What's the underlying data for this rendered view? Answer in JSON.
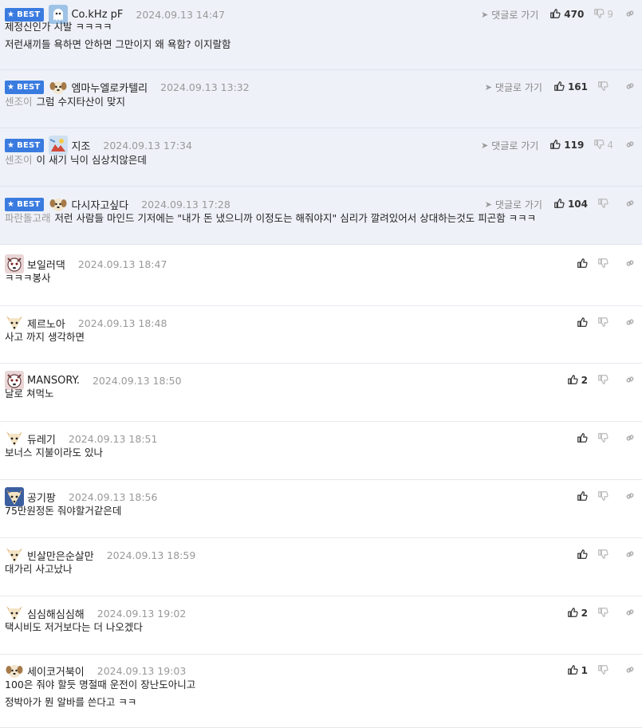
{
  "labels": {
    "best": "BEST",
    "goto_reply": "댓글로 가기"
  },
  "comments": [
    {
      "best": true,
      "nick": "Co.kHz pF",
      "date": "2024.09.13 14:47",
      "reply_to": "",
      "lines": [
        "제정신인가 시발 ㅋㅋㅋㅋ",
        "저런새끼들 욕하면 안하면 그만이지 왜 욕함? 이지랄함"
      ],
      "up": "470",
      "down": "9",
      "avatar": "ghost"
    },
    {
      "best": true,
      "nick": "엠마누엘로카텔리",
      "date": "2024.09.13 13:32",
      "reply_to": "센조이",
      "lines": [
        "그럼 수지타산이 맞지"
      ],
      "up": "161",
      "down": "",
      "avatar": "puppy"
    },
    {
      "best": true,
      "nick": "지조",
      "date": "2024.09.13 17:34",
      "reply_to": "센조이",
      "lines": [
        "이 새기 닉이 심상치않은데"
      ],
      "up": "119",
      "down": "4",
      "avatar": "art"
    },
    {
      "best": true,
      "nick": "다시자고싶다",
      "date": "2024.09.13 17:28",
      "reply_to": "파란돌고래",
      "lines": [
        "저런 사람들 마인드 기저에는 \"내가 돈 냈으니까 이정도는 해줘야지\" 심리가 깔려있어서 상대하는것도 피곤함 ㅋㅋㅋ"
      ],
      "up": "104",
      "down": "",
      "avatar": "puppy"
    },
    {
      "best": false,
      "nick": "보일러댁",
      "date": "2024.09.13 18:47",
      "reply_to": "",
      "lines": [
        "ㅋㅋㅋ봉사"
      ],
      "up": "",
      "down": "",
      "avatar": "dogface"
    },
    {
      "best": false,
      "nick": "제르노아",
      "date": "2024.09.13 18:48",
      "reply_to": "",
      "lines": [
        "사고 까지 생각하면"
      ],
      "up": "",
      "down": "",
      "avatar": "fennec"
    },
    {
      "best": false,
      "nick": "MANSORY.",
      "date": "2024.09.13 18:50",
      "reply_to": "",
      "lines": [
        "날로 쳐먹노"
      ],
      "up": "2",
      "down": "",
      "avatar": "dogface"
    },
    {
      "best": false,
      "nick": "듀레기",
      "date": "2024.09.13 18:51",
      "reply_to": "",
      "lines": [
        "보너스 지불이라도 있나"
      ],
      "up": "",
      "down": "",
      "avatar": "fennec"
    },
    {
      "best": false,
      "nick": "공기팡",
      "date": "2024.09.13 18:56",
      "reply_to": "",
      "lines": [
        "75만원정돈 줘야할거같은데"
      ],
      "up": "",
      "down": "",
      "avatar": "fennec2"
    },
    {
      "best": false,
      "nick": "빈살만은순살만",
      "date": "2024.09.13 18:59",
      "reply_to": "",
      "lines": [
        "대가리 사고났나"
      ],
      "up": "",
      "down": "",
      "avatar": "fennec"
    },
    {
      "best": false,
      "nick": "심심해심심해",
      "date": "2024.09.13 19:02",
      "reply_to": "",
      "lines": [
        "택시비도 저거보다는 더 나오겠다"
      ],
      "up": "2",
      "down": "",
      "avatar": "fennec"
    },
    {
      "best": false,
      "nick": "세이코거북이",
      "date": "2024.09.13 19:03",
      "reply_to": "",
      "lines": [
        "100은 줘야 할듯 명절때 운전이 장난도아니고",
        "정박아가 뭔 알바를 쓴다고 ㅋㅋ"
      ],
      "up": "1",
      "down": "",
      "avatar": "puppy"
    }
  ]
}
